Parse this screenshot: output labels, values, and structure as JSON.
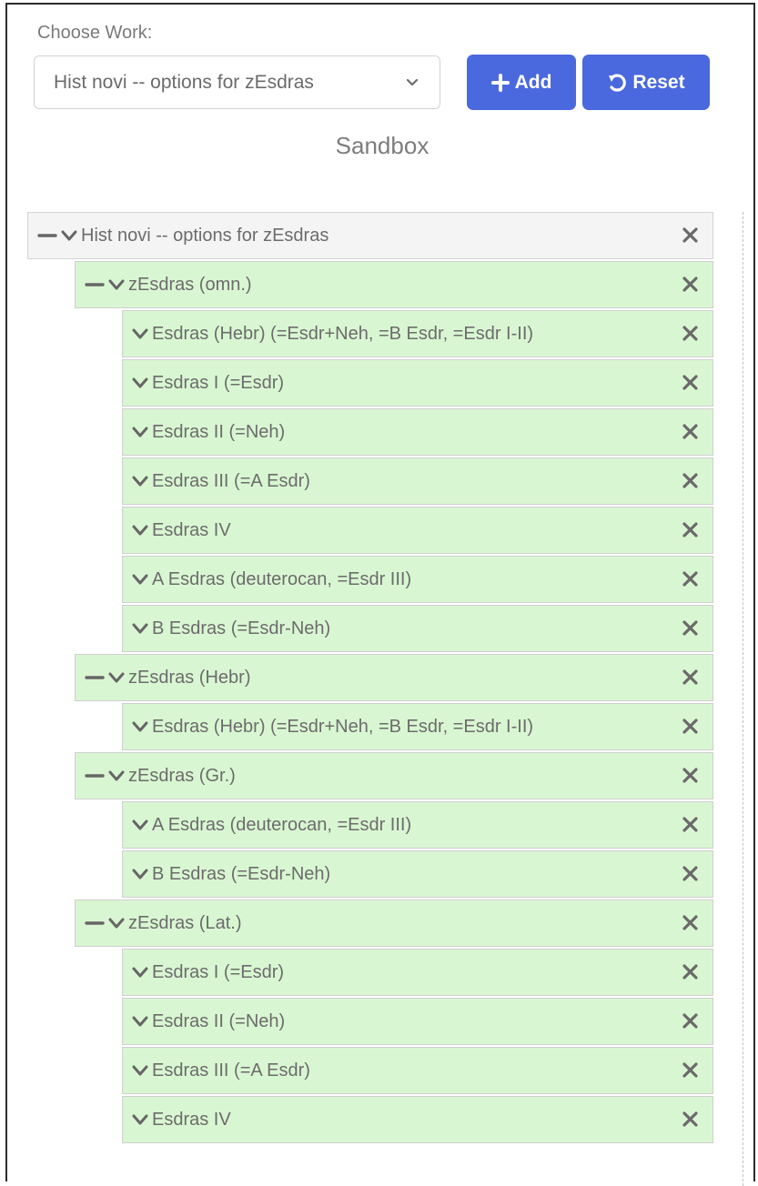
{
  "header": {
    "choose_label": "Choose Work:",
    "select_value": "Hist novi -- options for zEsdras",
    "add_label": "Add",
    "reset_label": "Reset",
    "sandbox_title": "Sandbox"
  },
  "tree": [
    {
      "label": "Hist novi -- options for zEsdras",
      "level": 0,
      "collapsible": true
    },
    {
      "label": "zEsdras (omn.)",
      "level": 1,
      "collapsible": true
    },
    {
      "label": "Esdras (Hebr) (=Esdr+Neh, =B Esdr, =Esdr I-II)",
      "level": 2,
      "collapsible": false
    },
    {
      "label": "Esdras I (=Esdr)",
      "level": 2,
      "collapsible": false
    },
    {
      "label": "Esdras II (=Neh)",
      "level": 2,
      "collapsible": false
    },
    {
      "label": "Esdras III (=A Esdr)",
      "level": 2,
      "collapsible": false
    },
    {
      "label": "Esdras IV",
      "level": 2,
      "collapsible": false
    },
    {
      "label": "A Esdras (deuterocan, =Esdr III)",
      "level": 2,
      "collapsible": false
    },
    {
      "label": "B Esdras (=Esdr-Neh)",
      "level": 2,
      "collapsible": false
    },
    {
      "label": "zEsdras (Hebr)",
      "level": 1,
      "collapsible": true
    },
    {
      "label": "Esdras (Hebr) (=Esdr+Neh, =B Esdr, =Esdr I-II)",
      "level": 2,
      "collapsible": false
    },
    {
      "label": "zEsdras (Gr.)",
      "level": 1,
      "collapsible": true
    },
    {
      "label": "A Esdras (deuterocan, =Esdr III)",
      "level": 2,
      "collapsible": false
    },
    {
      "label": "B Esdras (=Esdr-Neh)",
      "level": 2,
      "collapsible": false
    },
    {
      "label": "zEsdras (Lat.)",
      "level": 1,
      "collapsible": true
    },
    {
      "label": "Esdras I (=Esdr)",
      "level": 2,
      "collapsible": false
    },
    {
      "label": "Esdras II (=Neh)",
      "level": 2,
      "collapsible": false
    },
    {
      "label": "Esdras III (=A Esdr)",
      "level": 2,
      "collapsible": false
    },
    {
      "label": "Esdras IV",
      "level": 2,
      "collapsible": false
    }
  ],
  "colors": {
    "accent": "#4a69de",
    "node_bg": "#d9f6d2",
    "root_bg": "#f4f4f4"
  }
}
